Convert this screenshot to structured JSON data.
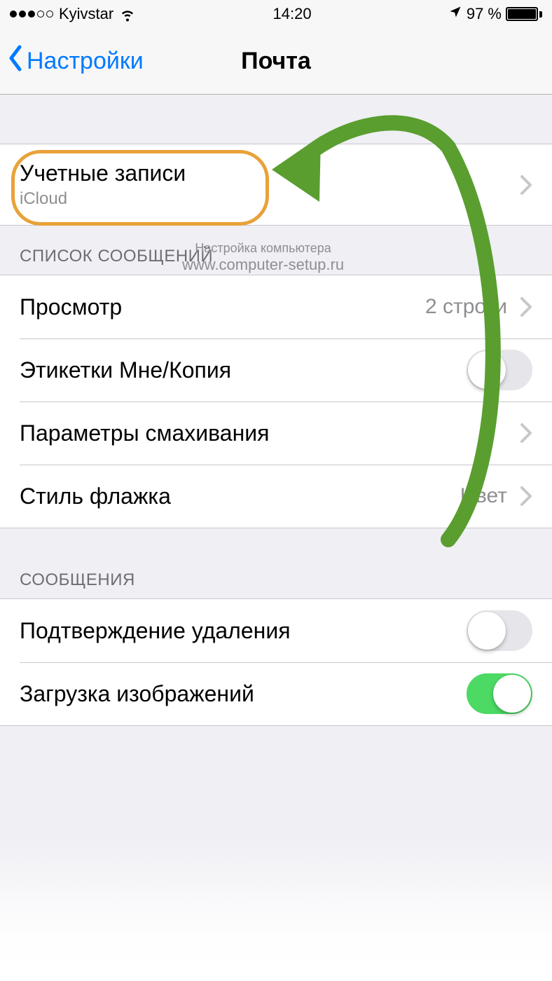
{
  "status": {
    "carrier": "Kyivstar",
    "time": "14:20",
    "battery_pct": "97 %"
  },
  "nav": {
    "back_label": "Настройки",
    "title": "Почта"
  },
  "accounts": {
    "title": "Учетные записи",
    "subtitle": "iCloud"
  },
  "section_list_header": "СПИСОК СООБЩЕНИЙ",
  "list": {
    "preview_label": "Просмотр",
    "preview_value": "2 строки",
    "labels_me_cc": "Этикетки Мне/Копия",
    "swipe_options": "Параметры смахивания",
    "flag_style_label": "Стиль флажка",
    "flag_style_value": "Цвет"
  },
  "section_messages_header": "СООБЩЕНИЯ",
  "messages": {
    "confirm_delete": "Подтверждение удаления",
    "load_images": "Загрузка изображений"
  },
  "watermark": {
    "line1": "Настройка компьютера",
    "line2": "www.computer-setup.ru"
  },
  "annotation": {
    "highlight_color": "#e8a23a",
    "arrow_color": "#5a9e2f"
  }
}
